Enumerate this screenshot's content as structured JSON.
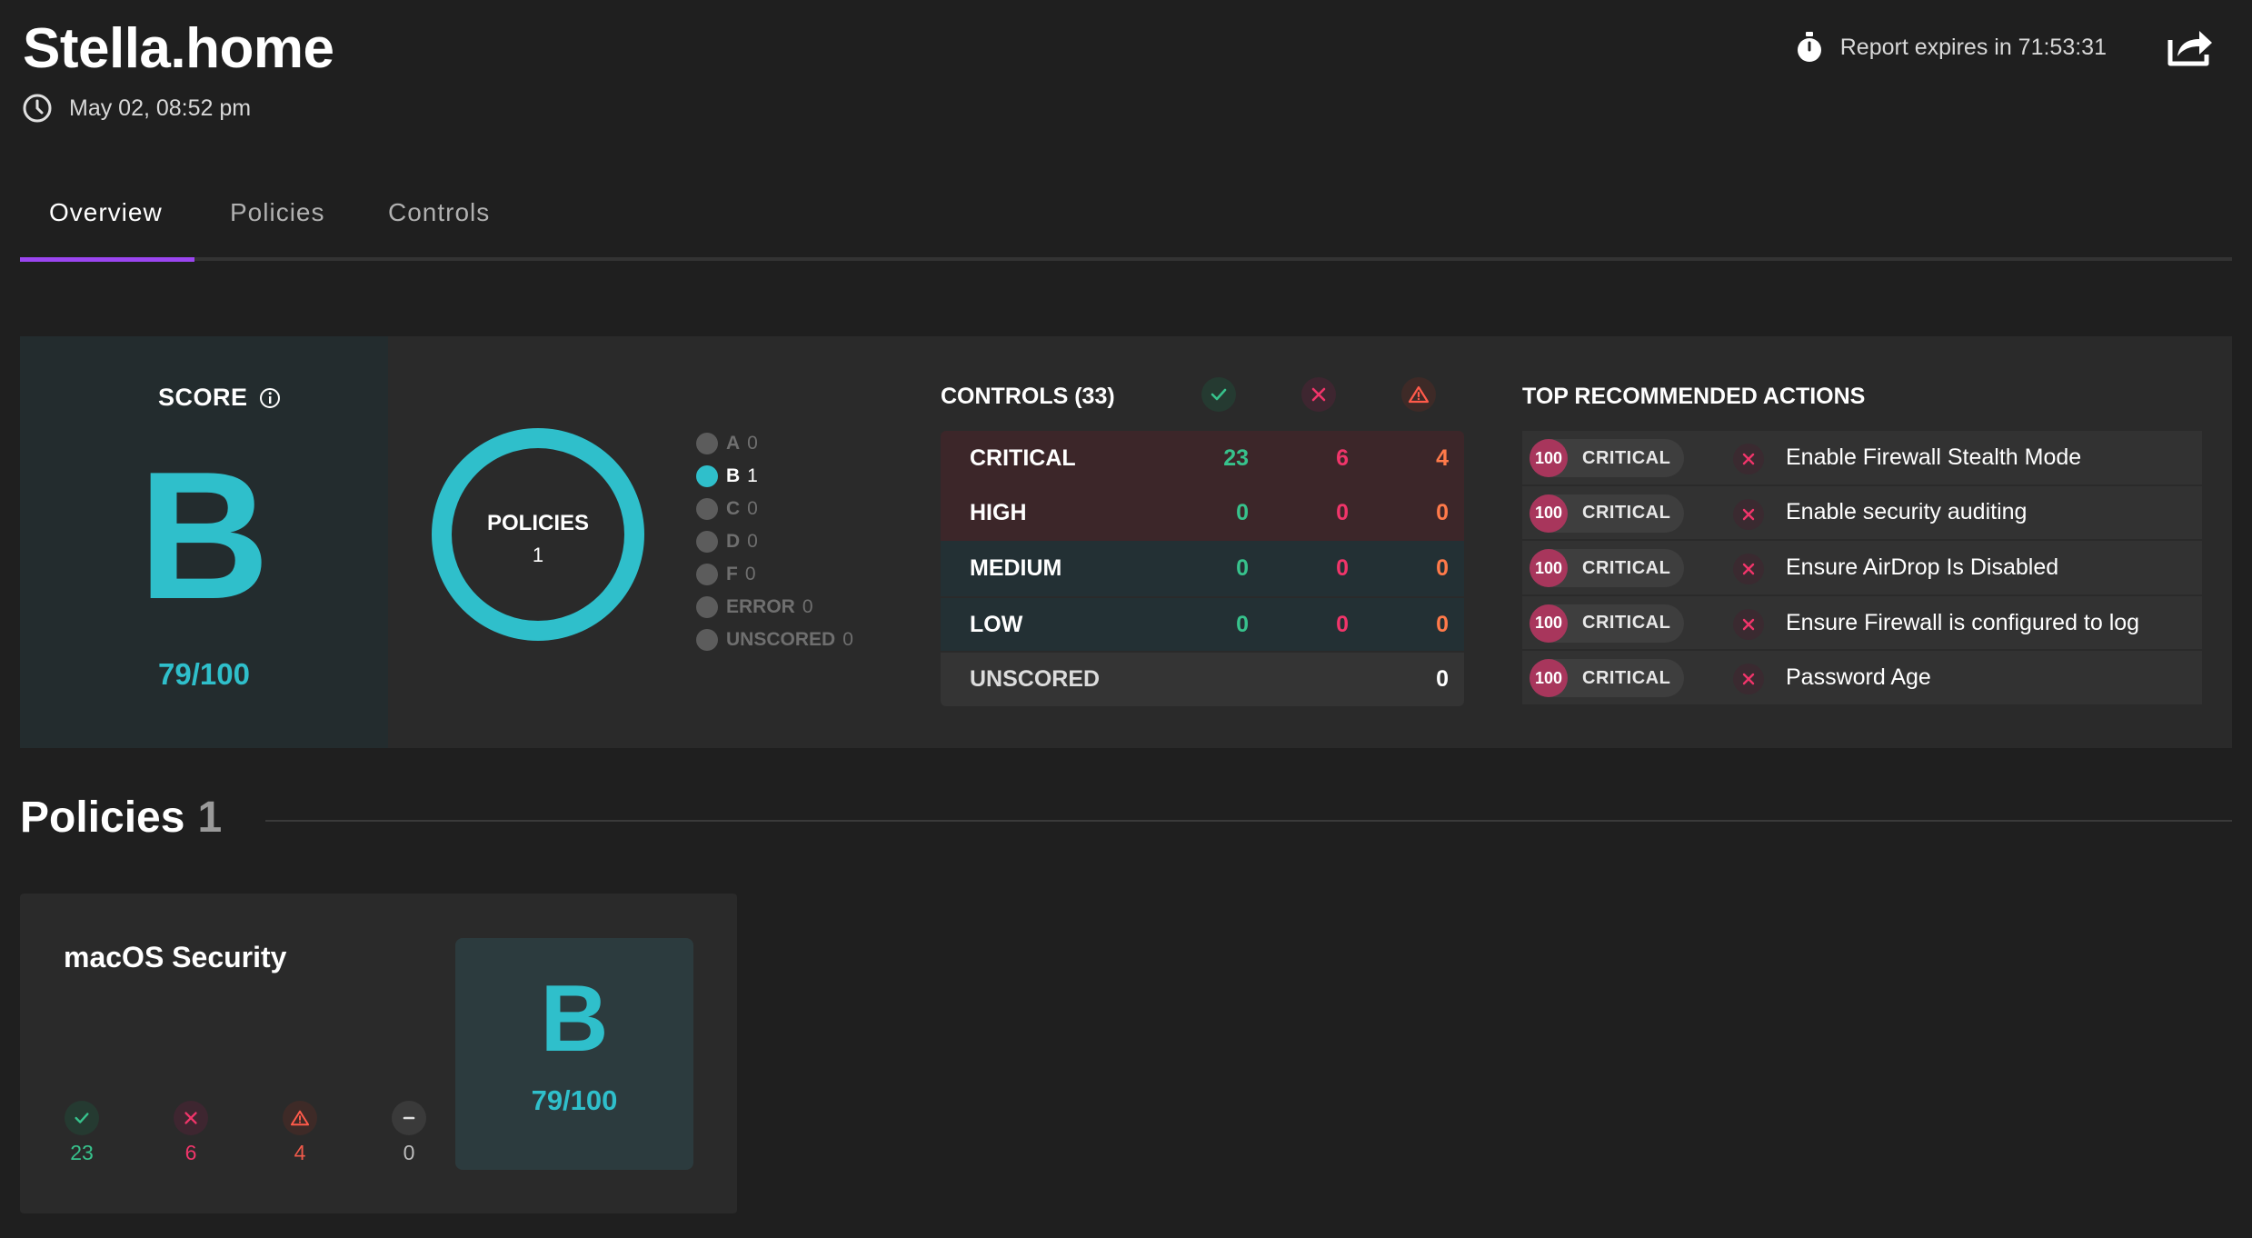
{
  "header": {
    "title": "Stella.home",
    "date": "May 02, 08:52 pm",
    "expires": "Report expires in 71:53:31"
  },
  "tabs": [
    {
      "label": "Overview",
      "active": true
    },
    {
      "label": "Policies",
      "active": false
    },
    {
      "label": "Controls",
      "active": false
    }
  ],
  "colors": {
    "accent": "#9b45f0",
    "grade": "#2fbfcb",
    "pass": "#37c28c",
    "fail": "#f0356a",
    "error": "#ff7a4a"
  },
  "score": {
    "label": "SCORE",
    "grade": "B",
    "value": "79/100"
  },
  "policies_ring": {
    "label": "POLICIES",
    "count": "1"
  },
  "grade_distribution": [
    {
      "grade": "A",
      "count": "0"
    },
    {
      "grade": "B",
      "count": "1"
    },
    {
      "grade": "C",
      "count": "0"
    },
    {
      "grade": "D",
      "count": "0"
    },
    {
      "grade": "F",
      "count": "0"
    },
    {
      "grade": "ERROR",
      "count": "0"
    },
    {
      "grade": "UNSCORED",
      "count": "0"
    }
  ],
  "controls": {
    "title": "CONTROLS (33)",
    "column_icons": [
      "check-icon",
      "x-icon",
      "warning-icon"
    ],
    "rows": [
      {
        "label": "CRITICAL",
        "pass": "23",
        "fail": "6",
        "error": "4"
      },
      {
        "label": "HIGH",
        "pass": "0",
        "fail": "0",
        "error": "0"
      },
      {
        "label": "MEDIUM",
        "pass": "0",
        "fail": "0",
        "error": "0"
      },
      {
        "label": "LOW",
        "pass": "0",
        "fail": "0",
        "error": "0"
      }
    ],
    "unscored": {
      "label": "UNSCORED",
      "count": "0"
    }
  },
  "top_actions": {
    "title": "TOP RECOMMENDED ACTIONS",
    "items": [
      {
        "score": "100",
        "severity": "CRITICAL",
        "text": "Enable Firewall Stealth Mode"
      },
      {
        "score": "100",
        "severity": "CRITICAL",
        "text": "Enable security auditing"
      },
      {
        "score": "100",
        "severity": "CRITICAL",
        "text": "Ensure AirDrop Is Disabled"
      },
      {
        "score": "100",
        "severity": "CRITICAL",
        "text": "Ensure Firewall is configured to log"
      },
      {
        "score": "100",
        "severity": "CRITICAL",
        "text": "Password Age"
      }
    ]
  },
  "policies_section": {
    "title": "Policies",
    "count": "1",
    "cards": [
      {
        "name": "macOS Security",
        "grade": "B",
        "score": "79/100",
        "pass": "23",
        "fail": "6",
        "error": "4",
        "skipped": "0"
      }
    ]
  }
}
